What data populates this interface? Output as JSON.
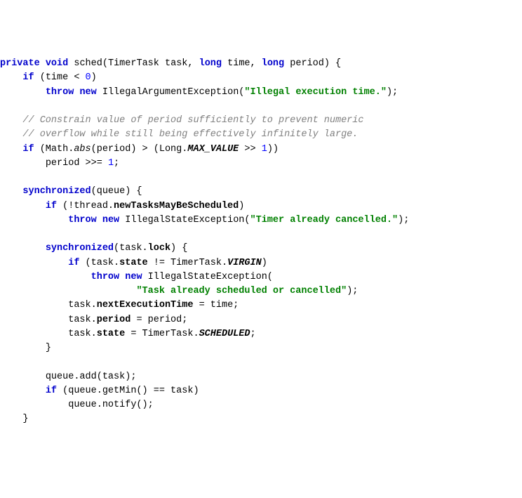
{
  "code": {
    "l1_private": "private",
    "l1_void": "void",
    "l1_method": "sched",
    "l1_type1": "TimerTask",
    "l1_param1": "task",
    "l1_long1": "long",
    "l1_param2": "time",
    "l1_long2": "long",
    "l1_param3": "period",
    "l2_if": "if",
    "l2_cond": "(time < ",
    "l2_zero": "0",
    "l2_close": ")",
    "l3_throw": "throw",
    "l3_new": "new",
    "l3_excl": "IllegalArgumentException(",
    "l3_str": "\"Illegal execution time.\"",
    "l3_end": ");",
    "l5_comment": "// Constrain value of period sufficiently to prevent numeric",
    "l6_comment": "// overflow while still being effectively infinitely large.",
    "l7_if": "if",
    "l7_open": " (Math.",
    "l7_abs": "abs",
    "l7_mid": "(period) > (Long.",
    "l7_max": "MAX_VALUE",
    "l7_shift": " >> ",
    "l7_one": "1",
    "l7_close": "))",
    "l8_body": "period >>= ",
    "l8_one": "1",
    "l8_semi": ";",
    "l10_sync": "synchronized",
    "l10_queue": "(queue) {",
    "l11_if": "if",
    "l11_open": " (!thread.",
    "l11_prop": "newTasksMayBeScheduled",
    "l11_close": ")",
    "l12_throw": "throw",
    "l12_new": "new",
    "l12_excl": "IllegalStateException(",
    "l12_str": "\"Timer already cancelled.\"",
    "l12_end": ");",
    "l14_sync": "synchronized",
    "l14_open": "(task.",
    "l14_lock": "lock",
    "l14_close": ") {",
    "l15_if": "if",
    "l15_open": " (task.",
    "l15_state": "state",
    "l15_neq": " != TimerTask.",
    "l15_virgin": "VIRGIN",
    "l15_close": ")",
    "l16_throw": "throw",
    "l16_new": "new",
    "l16_excl": "IllegalStateException(",
    "l17_str": "\"Task already scheduled or cancelled\"",
    "l17_end": ");",
    "l18_open": "task.",
    "l18_prop": "nextExecutionTime",
    "l18_rest": " = time;",
    "l19_open": "task.",
    "l19_prop": "period",
    "l19_rest": " = period;",
    "l20_open": "task.",
    "l20_prop": "state",
    "l20_mid": " = TimerTask.",
    "l20_sched": "SCHEDULED",
    "l20_semi": ";",
    "l21_close": "}",
    "l23_add": "queue.add(task);",
    "l24_if": "if",
    "l24_cond": " (queue.getMin() == task)",
    "l25_notify": "queue.notify();",
    "l26_close": "}"
  }
}
